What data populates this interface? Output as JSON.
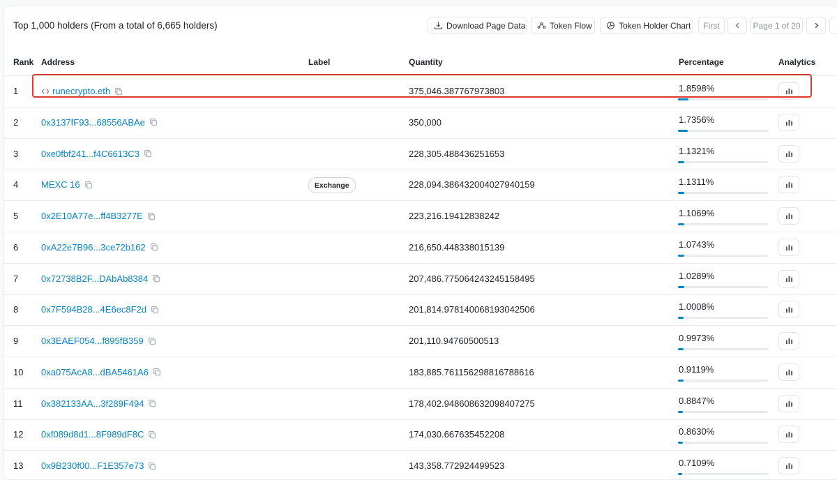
{
  "header": {
    "summary": "Top 1,000 holders (From a total of 6,665 holders)",
    "download_label": "Download Page Data",
    "token_flow_label": "Token Flow",
    "holder_chart_label": "Token Holder Chart",
    "first_label": "First",
    "page_label": "Page 1 of 20"
  },
  "columns": {
    "rank": "Rank",
    "address": "Address",
    "label": "Label",
    "quantity": "Quantity",
    "percentage": "Percentage",
    "analytics": "Analytics"
  },
  "colors": {
    "link": "#0784c3",
    "highlight": "#e0392b"
  },
  "rows": [
    {
      "rank": "1",
      "address": "runecrypto.eth",
      "label": "",
      "quantity": "375,046.387767973803",
      "percentage": "1.8598%",
      "share": 1.8598,
      "contract": true
    },
    {
      "rank": "2",
      "address": "0x3137fF93...68556ABAe",
      "label": "",
      "quantity": "350,000",
      "percentage": "1.7356%",
      "share": 1.7356
    },
    {
      "rank": "3",
      "address": "0xe0fbf241...f4C6613C3",
      "label": "",
      "quantity": "228,305.488436251653",
      "percentage": "1.1321%",
      "share": 1.1321
    },
    {
      "rank": "4",
      "address": "MEXC 16",
      "label": "Exchange",
      "quantity": "228,094.386432004027940159",
      "percentage": "1.1311%",
      "share": 1.1311
    },
    {
      "rank": "5",
      "address": "0x2E10A77e...ff4B3277E",
      "label": "",
      "quantity": "223,216.19412838242",
      "percentage": "1.1069%",
      "share": 1.1069
    },
    {
      "rank": "6",
      "address": "0xA22e7B96...3ce72b162",
      "label": "",
      "quantity": "216,650.448338015139",
      "percentage": "1.0743%",
      "share": 1.0743
    },
    {
      "rank": "7",
      "address": "0x72738B2F...DAbAb8384",
      "label": "",
      "quantity": "207,486.775064243245158495",
      "percentage": "1.0289%",
      "share": 1.0289
    },
    {
      "rank": "8",
      "address": "0x7F594B28...4E6ec8F2d",
      "label": "",
      "quantity": "201,814.978140068193042506",
      "percentage": "1.0008%",
      "share": 1.0008
    },
    {
      "rank": "9",
      "address": "0x3EAEF054...f895fB359",
      "label": "",
      "quantity": "201,110.94760500513",
      "percentage": "0.9973%",
      "share": 0.9973
    },
    {
      "rank": "10",
      "address": "0xa075AcA8...dBA5461A6",
      "label": "",
      "quantity": "183,885.761156298816788616",
      "percentage": "0.9119%",
      "share": 0.9119
    },
    {
      "rank": "11",
      "address": "0x382133AA...3f289F494",
      "label": "",
      "quantity": "178,402.948608632098407275",
      "percentage": "0.8847%",
      "share": 0.8847
    },
    {
      "rank": "12",
      "address": "0xf089d8d1...8F989dF8C",
      "label": "",
      "quantity": "174,030.667635452208",
      "percentage": "0.8630%",
      "share": 0.863
    },
    {
      "rank": "13",
      "address": "0x9B230f00...F1E357e73",
      "label": "",
      "quantity": "143,358.772924499523",
      "percentage": "0.7109%",
      "share": 0.7109
    }
  ]
}
